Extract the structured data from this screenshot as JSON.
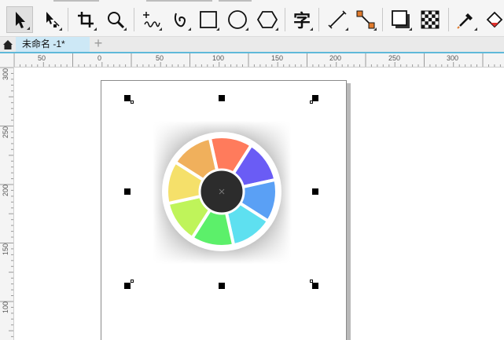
{
  "toolbar": {
    "tools": [
      {
        "name": "pick-tool",
        "icon": "arrow-pointer-icon"
      },
      {
        "name": "shape-tool",
        "icon": "node-edit-icon"
      },
      {
        "name": "crop-tool",
        "icon": "crop-icon"
      },
      {
        "name": "zoom-tool",
        "icon": "magnifier-icon"
      },
      {
        "name": "freehand-tool",
        "icon": "freehand-icon"
      },
      {
        "name": "artistic-media-tool",
        "icon": "spiral-curve-icon"
      },
      {
        "name": "rectangle-tool",
        "icon": "rectangle-icon"
      },
      {
        "name": "ellipse-tool",
        "icon": "ellipse-icon"
      },
      {
        "name": "polygon-tool",
        "icon": "hexagon-icon"
      },
      {
        "name": "text-tool",
        "icon": "text-icon"
      },
      {
        "name": "parallel-dimension-tool",
        "icon": "diagonal-line-icon"
      },
      {
        "name": "connector-tool",
        "icon": "connector-icon"
      },
      {
        "name": "drop-shadow-tool",
        "icon": "drop-shadow-icon"
      },
      {
        "name": "transparency-tool",
        "icon": "checkerboard-icon"
      },
      {
        "name": "eyedropper-tool",
        "icon": "eyedropper-icon"
      },
      {
        "name": "interactive-fill-tool",
        "icon": "paint-bucket-icon"
      }
    ],
    "text_tool_glyph": "字"
  },
  "tabs": {
    "document_tab": "未命名 -1*",
    "add_tab": "+"
  },
  "rulers": {
    "horizontal_labels": [
      "50",
      "0",
      "50",
      "100",
      "150",
      "200",
      "250",
      "300"
    ],
    "vertical_labels": [
      "300",
      "250",
      "200",
      "150",
      "100"
    ]
  },
  "artwork": {
    "segment_colors": [
      "#ff7b5c",
      "#6a5cf5",
      "#5aa0f5",
      "#5ee0f0",
      "#5cf06a",
      "#bff45a",
      "#f5e06a",
      "#f0b05c"
    ],
    "center_color": "#2c2c2c",
    "background_gradient": [
      "#2a2a2a",
      "#ffffff"
    ]
  },
  "colors": {
    "tab_active": "#cde8f6",
    "tab_underline": "#5fb9d9",
    "handle": "#000000"
  }
}
